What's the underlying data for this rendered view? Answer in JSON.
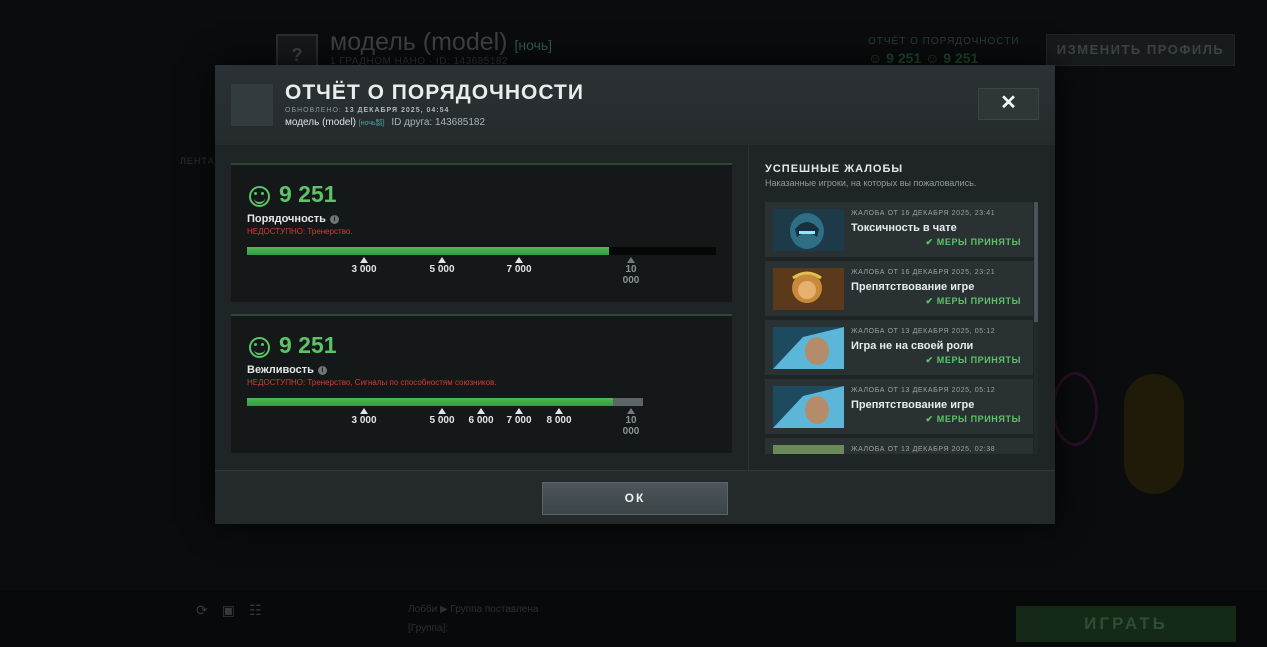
{
  "background": {
    "profile_name": "модель (model)",
    "profile_tag": "[ночь]",
    "profile_sub": "1 ГРАДНОМ НАНО · ID: 143685182",
    "conduct_label": "ОТЧЁТ О ПОРЯДОЧНОСТИ",
    "conduct_values": "☺ 9 251  ☺ 9 251",
    "edit_profile_label": "ИЗМЕНИТЬ ПРОФИЛЬ",
    "feed_label": "ЛЕНТА",
    "play_label": "ИГРАТЬ",
    "chat_line1": "Лобби ▶ Группа поставлена",
    "chat_line2": "[Группа]:"
  },
  "modal": {
    "title": "ОТЧЁТ О ПОРЯДОЧНОСТИ",
    "updated_label": "ОБНОВЛЕНО:",
    "updated_value": "13 ДЕКАБРЯ 2025, 04:54",
    "player_name": "модель (model)",
    "player_tag": "[ночь㍿]",
    "friend_id": "ID друга: 143685182",
    "close_label": "✕",
    "ok_label": "ОК"
  },
  "conduct": {
    "value": "9 251",
    "label": "Порядочность",
    "unavailable": "НЕДОСТУПНО: Тренерство.",
    "progress_fraction": 0.771,
    "ticks": [
      "3 000",
      "5 000",
      "7 000",
      "10 000"
    ]
  },
  "politeness": {
    "value": "9 251",
    "label": "Вежливость",
    "unavailable": "НЕДОСТУПНО: Тренерство, Сигналы по способностям союзников.",
    "progress_fraction": 0.925,
    "ticks": [
      "3 000",
      "5 000",
      "6 000",
      "7 000",
      "8 000",
      "10 000"
    ]
  },
  "reports": {
    "title": "УСПЕШНЫЕ ЖАЛОБЫ",
    "subtitle": "Наказанные игроки, на которых вы пожаловались.",
    "items": [
      {
        "date": "ЖАЛОБА ОТ 16 ДЕКАБРЯ 2025, 23:41",
        "reason": "Токсичность в чате",
        "status": "✔ МЕРЫ ПРИНЯТЫ"
      },
      {
        "date": "ЖАЛОБА ОТ 16 ДЕКАБРЯ 2025, 23:21",
        "reason": "Препятствование игре",
        "status": "✔ МЕРЫ ПРИНЯТЫ"
      },
      {
        "date": "ЖАЛОБА ОТ 13 ДЕКАБРЯ 2025, 05:12",
        "reason": "Игра не на своей роли",
        "status": "✔ МЕРЫ ПРИНЯТЫ"
      },
      {
        "date": "ЖАЛОБА ОТ 13 ДЕКАБРЯ 2025, 05:12",
        "reason": "Препятствование игре",
        "status": "✔ МЕРЫ ПРИНЯТЫ"
      },
      {
        "date": "ЖАЛОБА ОТ 13 ДЕКАБРЯ 2025, 02:38",
        "reason": "",
        "status": ""
      }
    ]
  },
  "colors": {
    "accent_green": "#5cc467",
    "warning_red": "#d33b36"
  }
}
